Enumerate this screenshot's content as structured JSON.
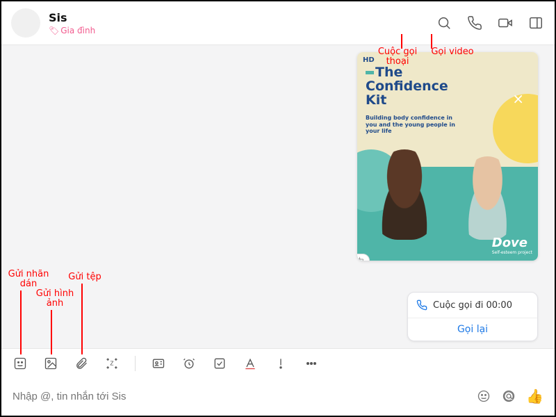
{
  "header": {
    "contact_name": "Sis",
    "contact_tag": "Gia đình"
  },
  "annotations": {
    "voice_call": "Cuộc gọi thoại",
    "video_call": "Gọi video",
    "sticker": "Gửi nhãn dán",
    "image": "Gửi hình ảnh",
    "file": "Gửi tệp"
  },
  "ad": {
    "hd": "HD",
    "title_line1": "The",
    "title_line2": "Confidence",
    "title_line3": "Kit",
    "subtitle": "Building body confidence in you and the young people in your life",
    "brand": "Dove",
    "brand_sub": "Self-esteem project"
  },
  "call_card": {
    "status": "Cuộc gọi đi 00:00",
    "action": "Gọi lại"
  },
  "input": {
    "placeholder": "Nhập @, tin nhắn tới Sis"
  },
  "icons": {
    "tag": "🏷"
  }
}
